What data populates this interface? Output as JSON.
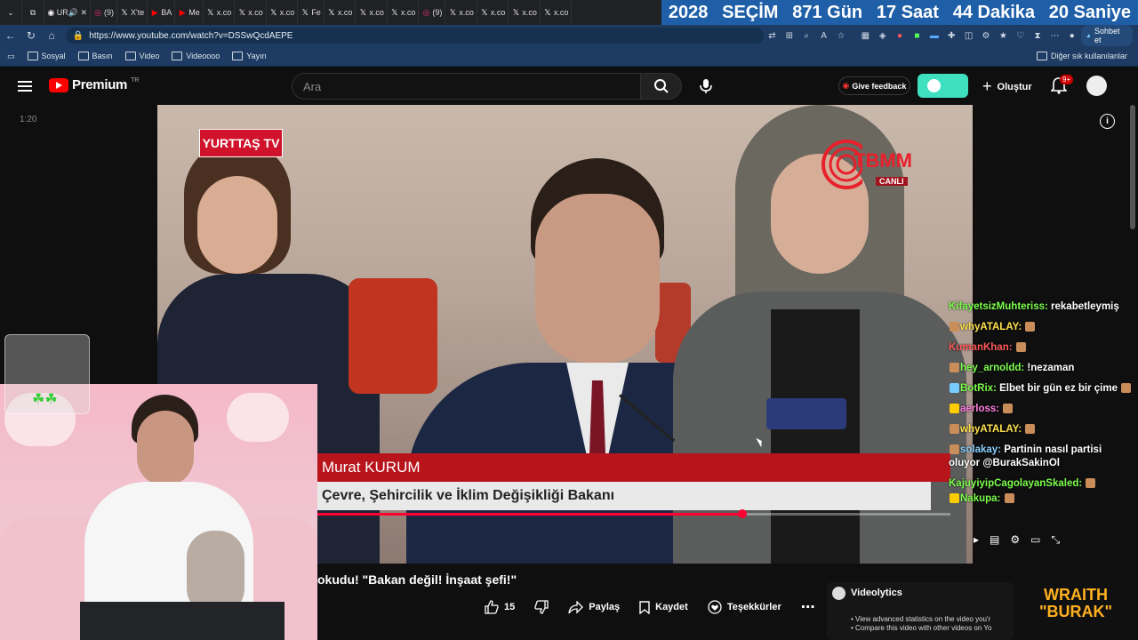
{
  "browser": {
    "tabs": [
      "UR",
      "(9)",
      "X'te",
      "BA",
      "Me",
      "x.co",
      "x.co",
      "x.co",
      "Fe",
      "x.co",
      "x.co",
      "x.co",
      "(9)",
      "x.co",
      "x.co",
      "x.co",
      "x.co"
    ],
    "url": "https://www.youtube.com/watch?v=DSSwQcdAEPE",
    "sohbet": "Sohbet et",
    "bookmarks": [
      "Sosyal",
      "Basın",
      "Video",
      "Videoooo",
      "Yayın"
    ],
    "other_bookmarks": "Diğer sık kullanılanlar"
  },
  "countdown": {
    "year": "2028",
    "label": "SEÇİM",
    "days": "871 Gün",
    "hours": "17 Saat",
    "minutes": "44 Dakika",
    "seconds": "20 Saniye"
  },
  "youtube": {
    "logo_text": "Premium",
    "region": "TR",
    "search_placeholder": "Ara",
    "feedback": "Give feedback",
    "create": "Oluştur",
    "notifications": "9+"
  },
  "video": {
    "side_time": "1:20",
    "channel_logo": "YURTTAŞ TV",
    "live_logo": "TBMM",
    "live_tag": "CANLI",
    "lower_third_name": "Murat KURUM",
    "lower_third_title": "Çevre, Şehircilik ve İklim Değişikliği Bakanı",
    "progress_fraction": 0.671,
    "title_partial": "okudu! \"Bakan değil! İnşaat şefi!\""
  },
  "chat": [
    {
      "user": "KifayetsizMuhteriss:",
      "text": " rekabetleymiş",
      "color": "un-g"
    },
    {
      "user": "whyATALAY:",
      "text": "",
      "color": "un-y"
    },
    {
      "user": "KumanKhan:",
      "text": "",
      "color": "un-r"
    },
    {
      "user": "hey_arnoldd:",
      "text": " !nezaman",
      "color": "un-g"
    },
    {
      "user": "BotRix:",
      "text": " Elbet bir gün ez bir çime",
      "color": "un-g"
    },
    {
      "user": "aerloss:",
      "text": "",
      "color": "un-p"
    },
    {
      "user": "whyATALAY:",
      "text": "",
      "color": "un-y"
    },
    {
      "user": "solakay:",
      "text": " Partinin nasıl partisi oluyor @BurakSakinOl",
      "color": "un-c"
    },
    {
      "user": "KajuyiyipCagolayanSkaled:",
      "text": "",
      "color": "un-g"
    },
    {
      "user": "Nakupa:",
      "text": "",
      "color": "un-g"
    }
  ],
  "actions": {
    "likes": "15",
    "share": "Paylaş",
    "save": "Kaydet",
    "thanks": "Teşekkürler"
  },
  "videolytics": {
    "title": "Videolytics",
    "items": [
      "View advanced statistics on the video you'r",
      "Compare this video with other videos on Yo"
    ]
  },
  "overlay_brand": {
    "line1": "WRAITH",
    "line2": "\"BURAK\""
  }
}
